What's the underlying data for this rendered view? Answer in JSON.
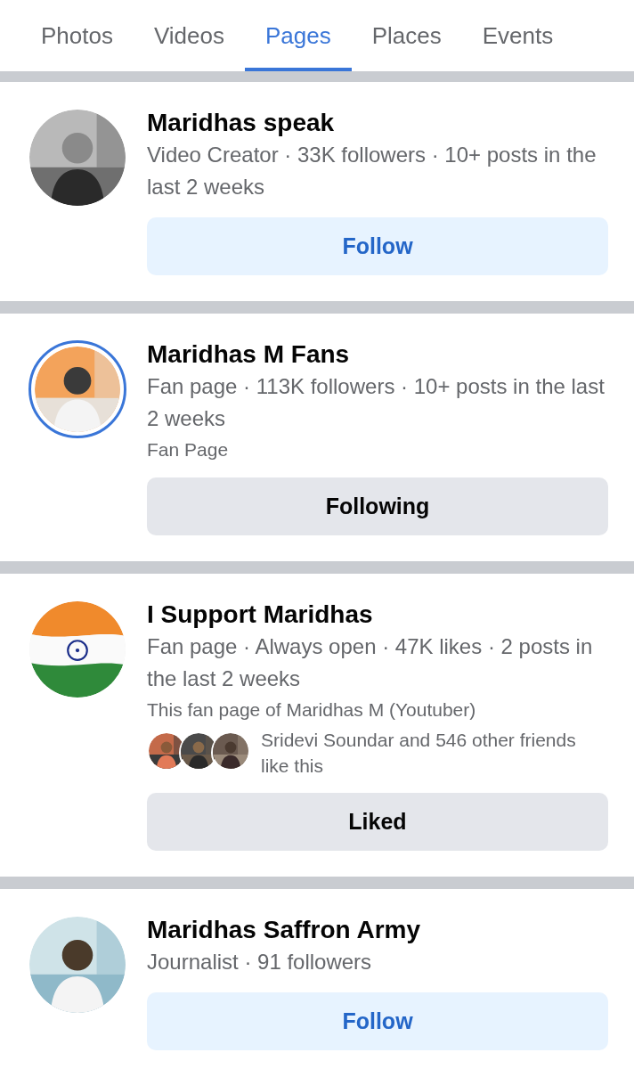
{
  "tabs": [
    {
      "label": "Photos",
      "selected": false
    },
    {
      "label": "Videos",
      "selected": false
    },
    {
      "label": "Pages",
      "selected": true
    },
    {
      "label": "Places",
      "selected": false
    },
    {
      "label": "Events",
      "selected": false
    }
  ],
  "pages": [
    {
      "name": "Maridhas speak",
      "avatar": {
        "kind": "portrait",
        "ring": false
      },
      "meta": "Video Creator · 33K followers · 10+ posts in the last 2 weeks",
      "button": {
        "label": "Follow",
        "kind": "primary"
      }
    },
    {
      "name": "Maridhas M Fans",
      "avatar": {
        "kind": "stage",
        "ring": true
      },
      "meta": "Fan page · 113K followers · 10+ posts in the last 2 weeks",
      "category": "Fan Page",
      "button": {
        "label": "Following",
        "kind": "secondary"
      }
    },
    {
      "name": "I Support Maridhas",
      "avatar": {
        "kind": "flag",
        "ring": false
      },
      "meta": "Fan page · Always open · 47K likes · 2 posts in the last 2 weeks",
      "category": "This fan page of Maridhas M (Youtuber)",
      "friends": {
        "text": "Sridevi Soundar and 546 other friends like this"
      },
      "button": {
        "label": "Liked",
        "kind": "secondary"
      }
    },
    {
      "name": "Maridhas Saffron Army",
      "avatar": {
        "kind": "outdoor",
        "ring": false
      },
      "meta": "Journalist · 91 followers",
      "button": {
        "label": "Follow",
        "kind": "primary"
      }
    }
  ]
}
